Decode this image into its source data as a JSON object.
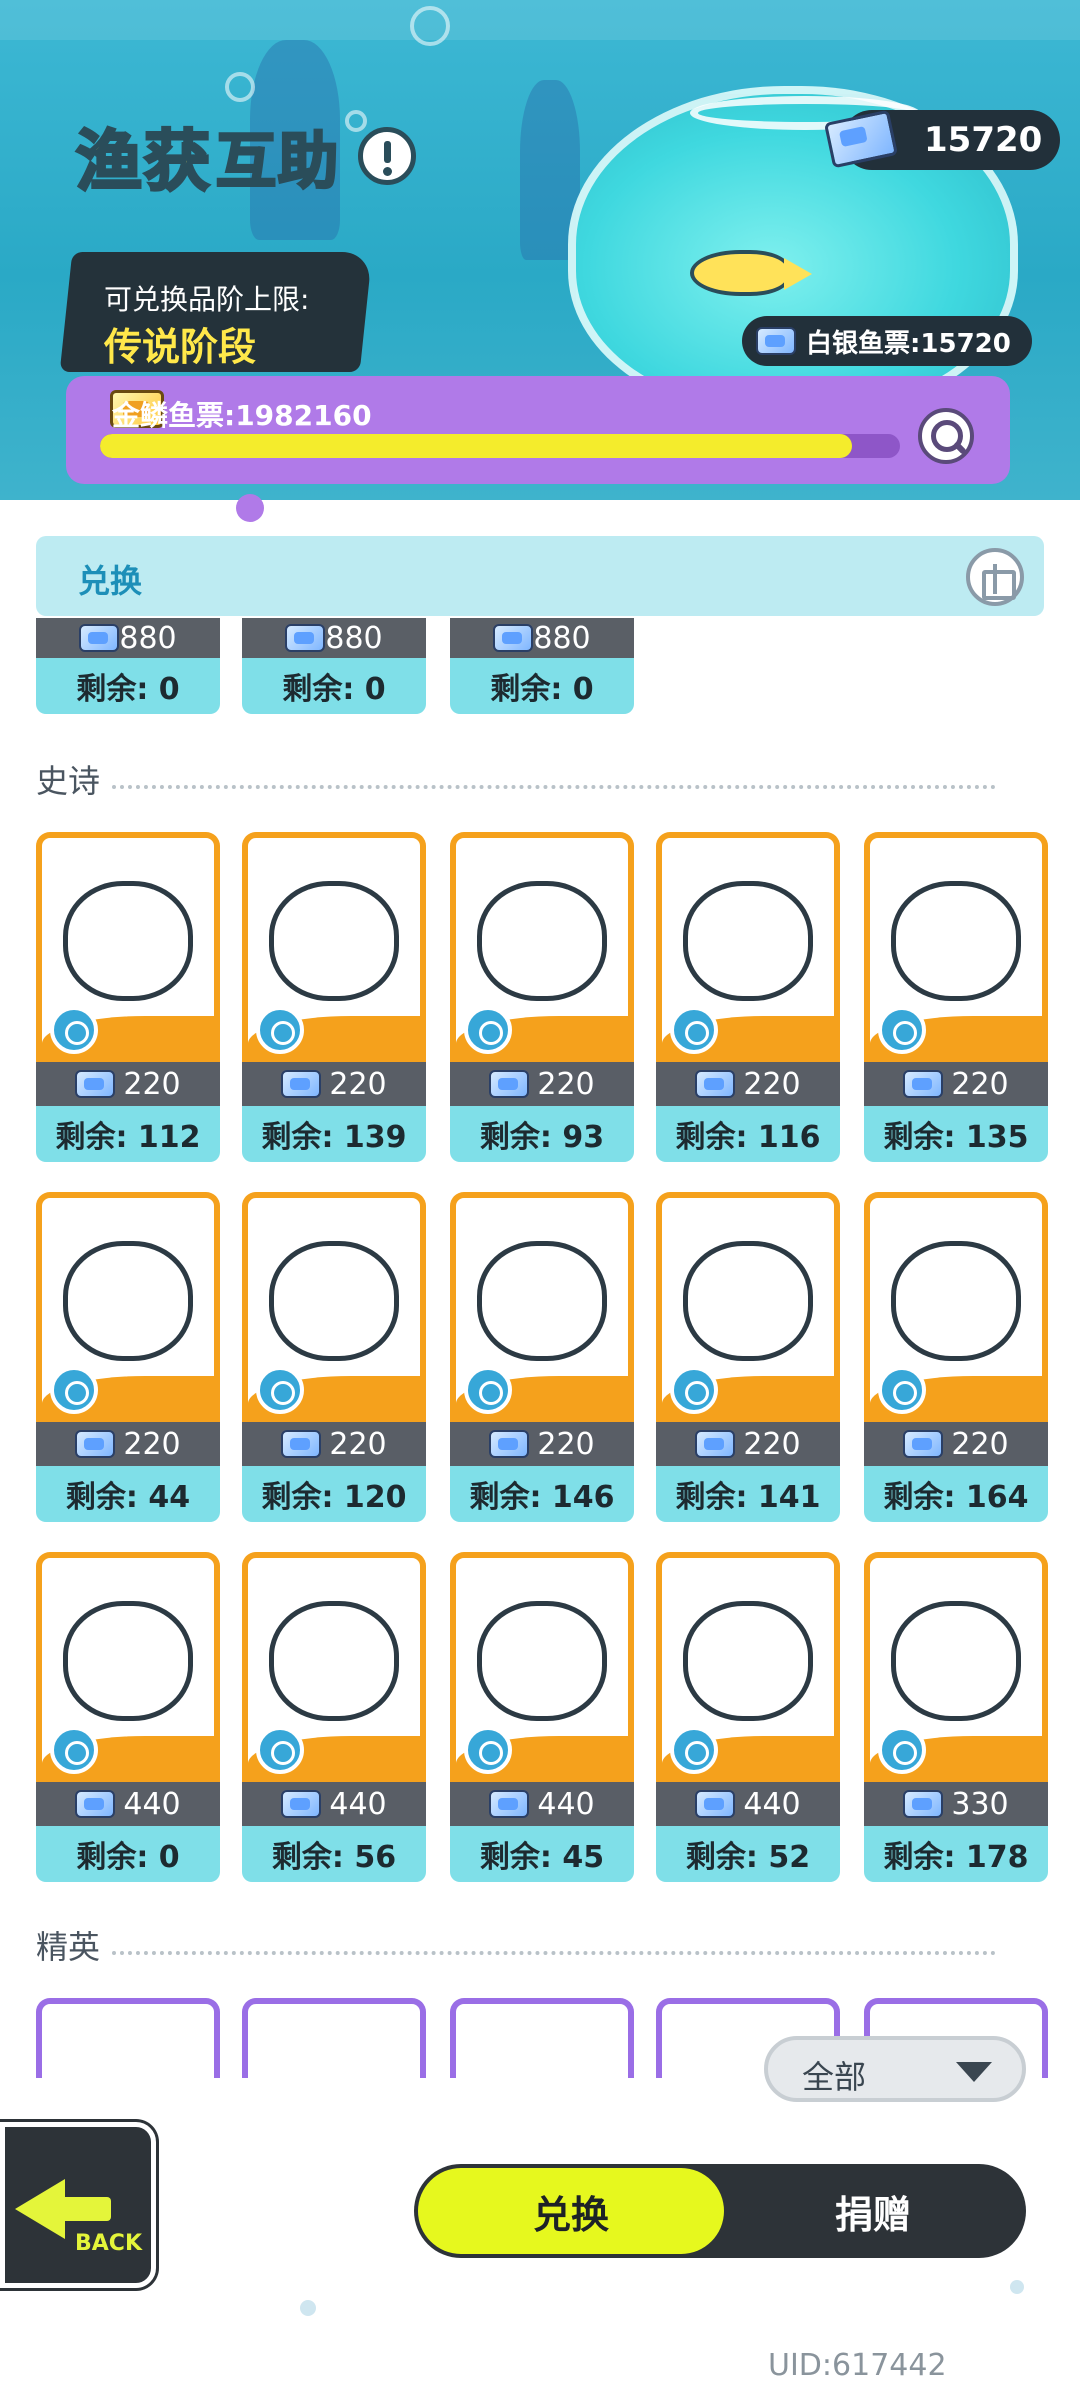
{
  "header": {
    "title_main": "渔获",
    "title_sub": "互助",
    "tier_label": "可兑换品阶上限:",
    "tier_value": "传说阶段",
    "top_currency": "15720",
    "silver_ticket": "白银鱼票:15720",
    "gold_ticket": "金鳞鱼票:1982160",
    "gold_progress": 0.94
  },
  "section": {
    "title": "兑换"
  },
  "partial_row": [
    {
      "price": "880",
      "remain": "剩余: 0"
    },
    {
      "price": "880",
      "remain": "剩余: 0"
    },
    {
      "price": "880",
      "remain": "剩余: 0"
    }
  ],
  "epic": {
    "label": "史诗",
    "rows": [
      [
        {
          "icon": "blue-fish-icon",
          "price": "220",
          "remain": "剩余: 112"
        },
        {
          "icon": "striped-fish-icon",
          "price": "220",
          "remain": "剩余: 139"
        },
        {
          "icon": "dolphin-icon",
          "price": "220",
          "remain": "剩余: 93"
        },
        {
          "icon": "sponge-icon",
          "price": "220",
          "remain": "剩余: 116"
        },
        {
          "icon": "ammonite-icon",
          "price": "220",
          "remain": "剩余: 135"
        }
      ],
      [
        {
          "icon": "shell-icon",
          "price": "220",
          "remain": "剩余: 44"
        },
        {
          "icon": "bottle-icon",
          "price": "220",
          "remain": "剩余: 120"
        },
        {
          "icon": "trash-can-icon",
          "price": "220",
          "remain": "剩余: 146"
        },
        {
          "icon": "sea-slug-icon",
          "price": "220",
          "remain": "剩余: 141"
        },
        {
          "icon": "sea-urchin-icon",
          "price": "220",
          "remain": "剩余: 164"
        }
      ],
      [
        {
          "icon": "goldfish-icon",
          "price": "440",
          "remain": "剩余: 0"
        },
        {
          "icon": "conch-icon",
          "price": "440",
          "remain": "剩余: 56"
        },
        {
          "icon": "orb-icon",
          "price": "440",
          "remain": "剩余: 45"
        },
        {
          "icon": "coral-icon",
          "price": "440",
          "remain": "剩余: 52"
        },
        {
          "icon": "ore-icon",
          "price": "330",
          "remain": "剩余: 178"
        }
      ]
    ]
  },
  "elite": {
    "label": "精英"
  },
  "filter": {
    "label": "全部"
  },
  "back": {
    "label": "BACK"
  },
  "toggle": {
    "exchange": "兑换",
    "donate": "捐赠"
  },
  "uid": "UID:617442"
}
